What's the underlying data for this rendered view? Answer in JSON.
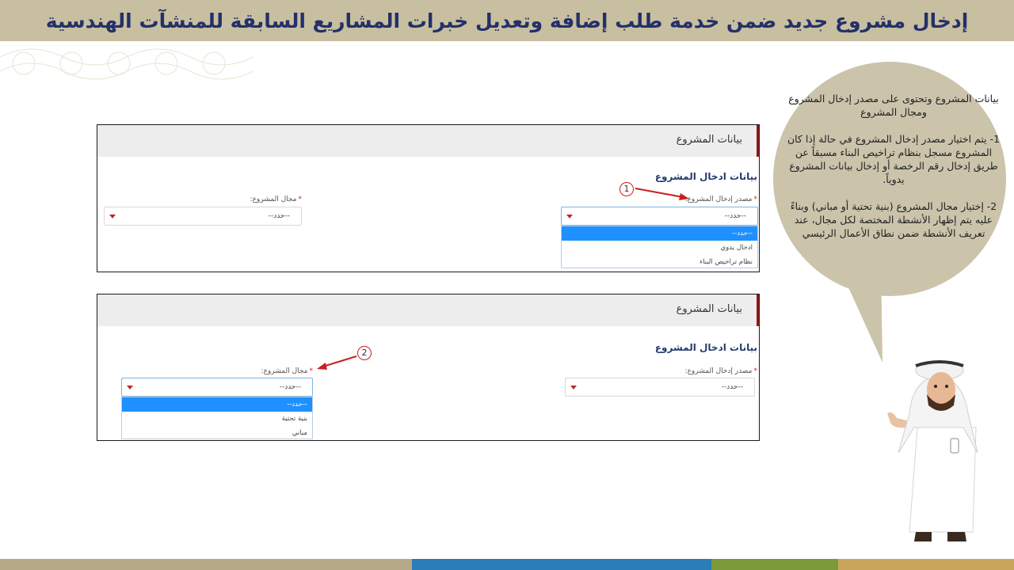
{
  "slide": {
    "title": "إدخال مشروع جديد ضمن خدمة طلب إضافة وتعديل خبرات المشاريع السابقة للمنشآت الهندسية"
  },
  "panel1": {
    "header": "بيانات المشروع",
    "section": "بيانات ادخال المشروع",
    "source_label": "مصدر إدخال المشروع:",
    "source_value": "--حدد--",
    "source_options": [
      "--حدد--",
      "ادخال يدوي",
      "نظام تراخيص البناء"
    ],
    "field_label": "مجال المشروع:",
    "field_value": "--حدد--",
    "badge": "1"
  },
  "panel2": {
    "header": "بيانات المشروع",
    "section": "بيانات ادخال المشروع",
    "source_label": "مصدر إدخال المشروع:",
    "source_value": "--حدد--",
    "field_label": "مجال المشروع:",
    "field_value": "--حدد--",
    "field_options": [
      "--حدد--",
      "بنية تحتية",
      "مباني"
    ],
    "badge": "2"
  },
  "required_mark": "*",
  "bubble": {
    "intro": "بيانات المشروع وتحتوى على مصدر إدخال المشروع ومجال المشروع",
    "step1": "1- يتم اختيار مصدر إدخال المشروع في حالة إذا كان المشروع مسجل بنظام تراخيص البناء مسبقاً عن طريق إدخال رقم الرخصة أو إدخال بيانات المشروع يدوياً.",
    "step2": "2- إختيار مجال المشروع (بنية تحتية أو مباني) وبناءً عليه يتم إظهار الأنشطة المختصة لكل مجال، عند تعريف الأنشطة ضمن نطاق الأعمال الرئيسي"
  },
  "colors": {
    "title_bar": "#c7bf9f",
    "title_text": "#24306a",
    "accent_red": "#c0262c",
    "option_active": "#1e90ff",
    "footer": [
      "#b5a988",
      "#2a7db6",
      "#7a9a3a",
      "#c9a55b"
    ]
  },
  "icons": {
    "caret": "caret-down-icon",
    "arrow": "annotation-arrow-icon",
    "character": "presenter-character-icon"
  }
}
